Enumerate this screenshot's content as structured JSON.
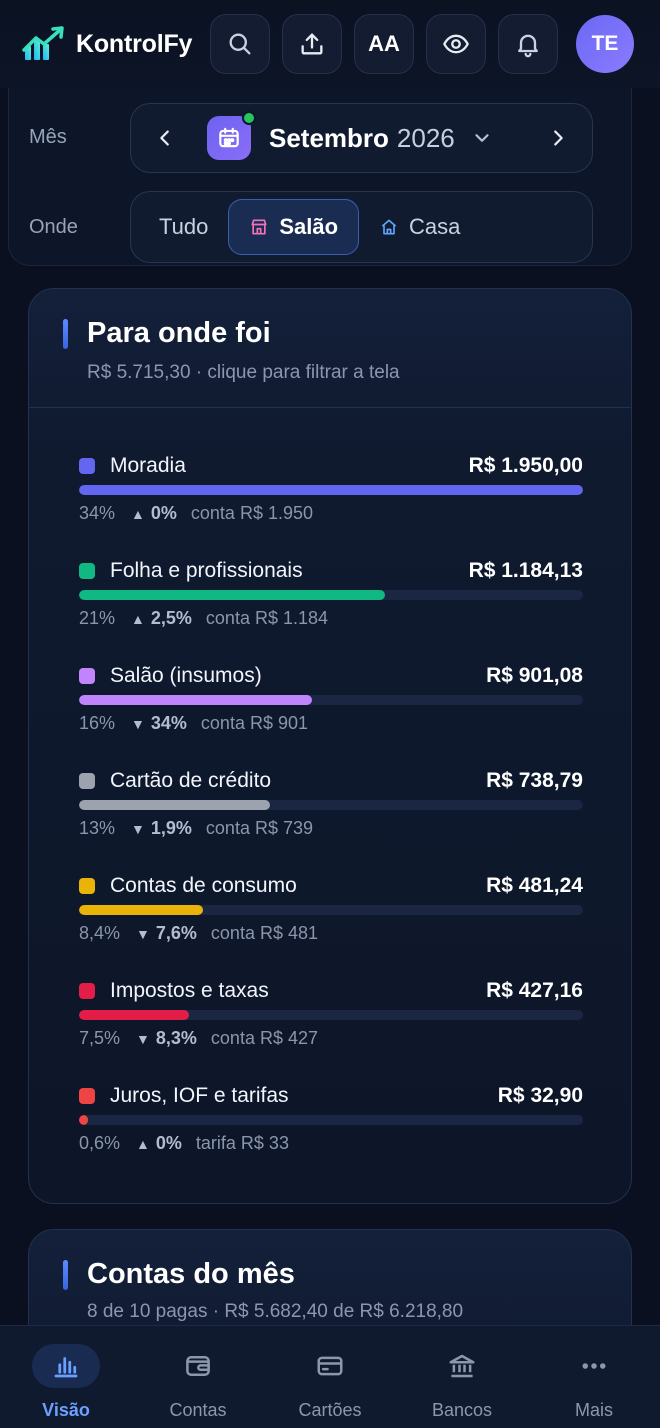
{
  "app": {
    "name": "KontrolFy",
    "avatar_initials": "TE",
    "font_button_label": "AA"
  },
  "filters": {
    "month_label": "Mês",
    "month_name": "Setembro",
    "year": "2026",
    "where_label": "Onde",
    "segments": [
      {
        "label": "Tudo",
        "active": false
      },
      {
        "label": "Salão",
        "active": true,
        "icon": "store-icon"
      },
      {
        "label": "Casa",
        "active": false,
        "icon": "home-icon"
      }
    ]
  },
  "spending": {
    "title": "Para onde foi",
    "subtitle": "R$ 5.715,30 · clique para filtrar a tela",
    "categories": [
      {
        "name": "Moradia",
        "amount": "R$ 1.950,00",
        "share": 1.0,
        "color": "#6366f1",
        "pct": "34%",
        "trend_dir": "▲",
        "trend": "0%",
        "detail": "conta R$ 1.950"
      },
      {
        "name": "Folha e profissionais",
        "amount": "R$ 1.184,13",
        "share": 0.607,
        "color": "#10b981",
        "pct": "21%",
        "trend_dir": "▲",
        "trend": "2,5%",
        "detail": "conta R$ 1.184"
      },
      {
        "name": "Salão (insumos)",
        "amount": "R$ 901,08",
        "share": 0.462,
        "color": "#c084fc",
        "pct": "16%",
        "trend_dir": "▼",
        "trend": "34%",
        "detail": "conta R$ 901"
      },
      {
        "name": "Cartão de crédito",
        "amount": "R$ 738,79",
        "share": 0.379,
        "color": "#9ca3af",
        "pct": "13%",
        "trend_dir": "▼",
        "trend": "1,9%",
        "detail": "conta R$ 739"
      },
      {
        "name": "Contas de consumo",
        "amount": "R$ 481,24",
        "share": 0.247,
        "color": "#eab308",
        "pct": "8,4%",
        "trend_dir": "▼",
        "trend": "7,6%",
        "detail": "conta R$ 481"
      },
      {
        "name": "Impostos e taxas",
        "amount": "R$ 427,16",
        "share": 0.219,
        "color": "#e11d48",
        "pct": "7,5%",
        "trend_dir": "▼",
        "trend": "8,3%",
        "detail": "conta R$ 427"
      },
      {
        "name": "Juros, IOF e tarifas",
        "amount": "R$ 32,90",
        "share": 0.017,
        "color": "#ef4444",
        "pct": "0,6%",
        "trend_dir": "▲",
        "trend": "0%",
        "detail": "tarifa R$ 33"
      }
    ]
  },
  "bills": {
    "title": "Contas do mês",
    "subtitle": "8 de 10 pagas · R$ 5.682,40 de R$ 6.218,80"
  },
  "bottom_nav": [
    {
      "label": "Visão",
      "icon": "chart-icon",
      "active": true
    },
    {
      "label": "Contas",
      "icon": "wallet-icon",
      "active": false
    },
    {
      "label": "Cartões",
      "icon": "credit-card-icon",
      "active": false
    },
    {
      "label": "Bancos",
      "icon": "bank-icon",
      "active": false
    },
    {
      "label": "Mais",
      "icon": "more-icon",
      "active": false
    }
  ]
}
